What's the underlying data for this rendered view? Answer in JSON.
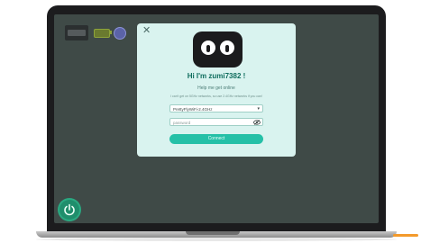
{
  "dialog": {
    "greeting": "Hi I'm zumi7382 !",
    "subtitle": "Help me get online",
    "note": "I can't get on 5GHz networks, so use 2.4GHz networks if you can!",
    "network_value": "PrettyFlyWiFi-2.4GHz",
    "password_placeholder": "password",
    "connect_label": "Connect"
  },
  "icons": {
    "close": "close-icon",
    "chevron": "chevron-down-icon",
    "eye_off": "eye-off-icon",
    "power": "power-icon",
    "battery": "battery-icon",
    "globe": "globe-icon"
  },
  "colors": {
    "accent": "#25c0a7",
    "dialog_bg": "#d9f3ef",
    "screen_bg": "#3f4a47"
  }
}
